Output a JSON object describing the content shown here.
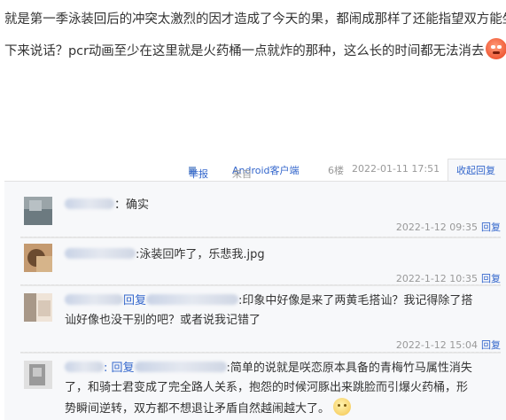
{
  "post": {
    "lines": [
      "就是第一季泳装回后的冲突太激烈的因才造成了今天的果，都闹成那样了还能指望双方能坐",
      "下来说话？pcr动画至少在这里就是火药桶一点就炸的那种，这么长的时间都无法消去"
    ],
    "emoji": "angry-face-icon"
  },
  "meta": {
    "report": "举报",
    "client_prefix": "来自",
    "client": "Android客户端",
    "floor": "6楼",
    "date": "2022-01-11 17:51",
    "reply_toggle": "收起回复"
  },
  "replies": [
    {
      "text": "：确实",
      "timestamp": "2022-1-12 09:35",
      "reply_label": "回复",
      "avatar_colors": [
        "#9aa4a8",
        "#6c7a80",
        "#b8c0c4",
        "#8896a0"
      ]
    },
    {
      "text": ":泳装回咋了，乐悲我.jpg",
      "timestamp": "2022-1-12 10:35",
      "reply_label": "回复",
      "avatar_colors": [
        "#a07a55",
        "#d6b48a",
        "#6b4b30",
        "#c49a70"
      ]
    },
    {
      "prefix": "回复",
      "line1": ":印象中好像是来了两黄毛搭讪？我记得除了搭",
      "line2": "讪好像也没干别的吧？或者说我记错了",
      "timestamp": "2022-1-12 15:04",
      "reply_label": "回复",
      "avatar_colors": [
        "#d8c8b8",
        "#a89888",
        "#efe4d8",
        "#8a7868"
      ]
    },
    {
      "prefix": ": 回复",
      "line1": ":简单的说就是咲恋原本具备的青梅竹马属性消失",
      "line2": "了，和骑士君变成了完全路人关系，抱怨的时候河豚出来跳脸而引爆火药桶，形",
      "line3": "势瞬间逆转，双方都不想退让矛盾自然越闹越大了。",
      "emoji": "smile-face-icon",
      "avatar_colors": [
        "#c8c8c8",
        "#9a9a9a",
        "#e0e0e0",
        "#b0b0b0"
      ]
    }
  ]
}
